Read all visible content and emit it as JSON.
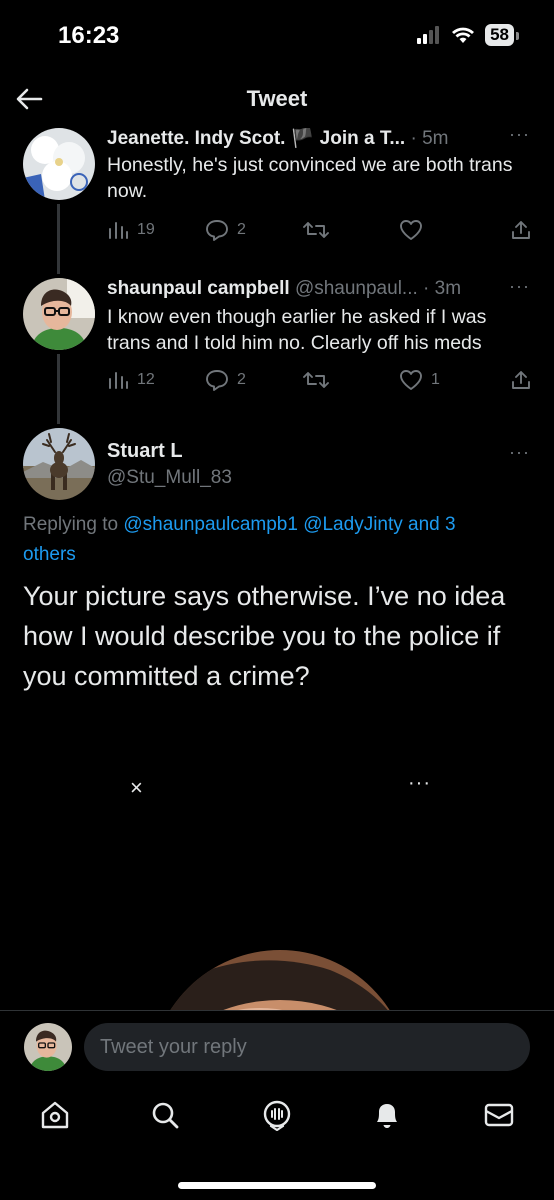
{
  "status_bar": {
    "time": "16:23",
    "battery": "58"
  },
  "header": {
    "title": "Tweet"
  },
  "tweets": [
    {
      "name": "Jeanette. Indy Scot. 🏴 Join a T...",
      "handle": "",
      "time": "· 5m",
      "text": "Honestly, he's just convinced we are both trans now.",
      "stats": {
        "views": "19",
        "replies": "2",
        "retweets": "",
        "likes": ""
      }
    },
    {
      "name": "shaunpaul campbell",
      "handle": "@shaunpaul...",
      "time": "· 3m",
      "text": "I know even though earlier he asked if I was trans and I told him no. Clearly off his meds",
      "stats": {
        "views": "12",
        "replies": "2",
        "retweets": "",
        "likes": "1"
      }
    }
  ],
  "main_tweet": {
    "name": "Stuart L",
    "handle": "@Stu_Mull_83",
    "replying_prefix": "Replying to",
    "mention1": "@shaunpaulcampb1",
    "mention2": "@LadyJinty",
    "mention_and": "and 3",
    "mention_others": "others",
    "text": "Your picture says otherwise. I’ve no idea how I would describe you to the police if you committed a crime?"
  },
  "media": {
    "close_glyph": "×",
    "more_glyph": "···"
  },
  "reply_bar": {
    "placeholder": "Tweet your reply"
  },
  "colors": {
    "accent": "#1d9bf0",
    "muted": "#71767b",
    "text": "#e7e9ea",
    "background": "#000000"
  },
  "tabs": [
    "home-icon",
    "search-icon",
    "spaces-icon",
    "notifications-icon",
    "messages-icon"
  ]
}
